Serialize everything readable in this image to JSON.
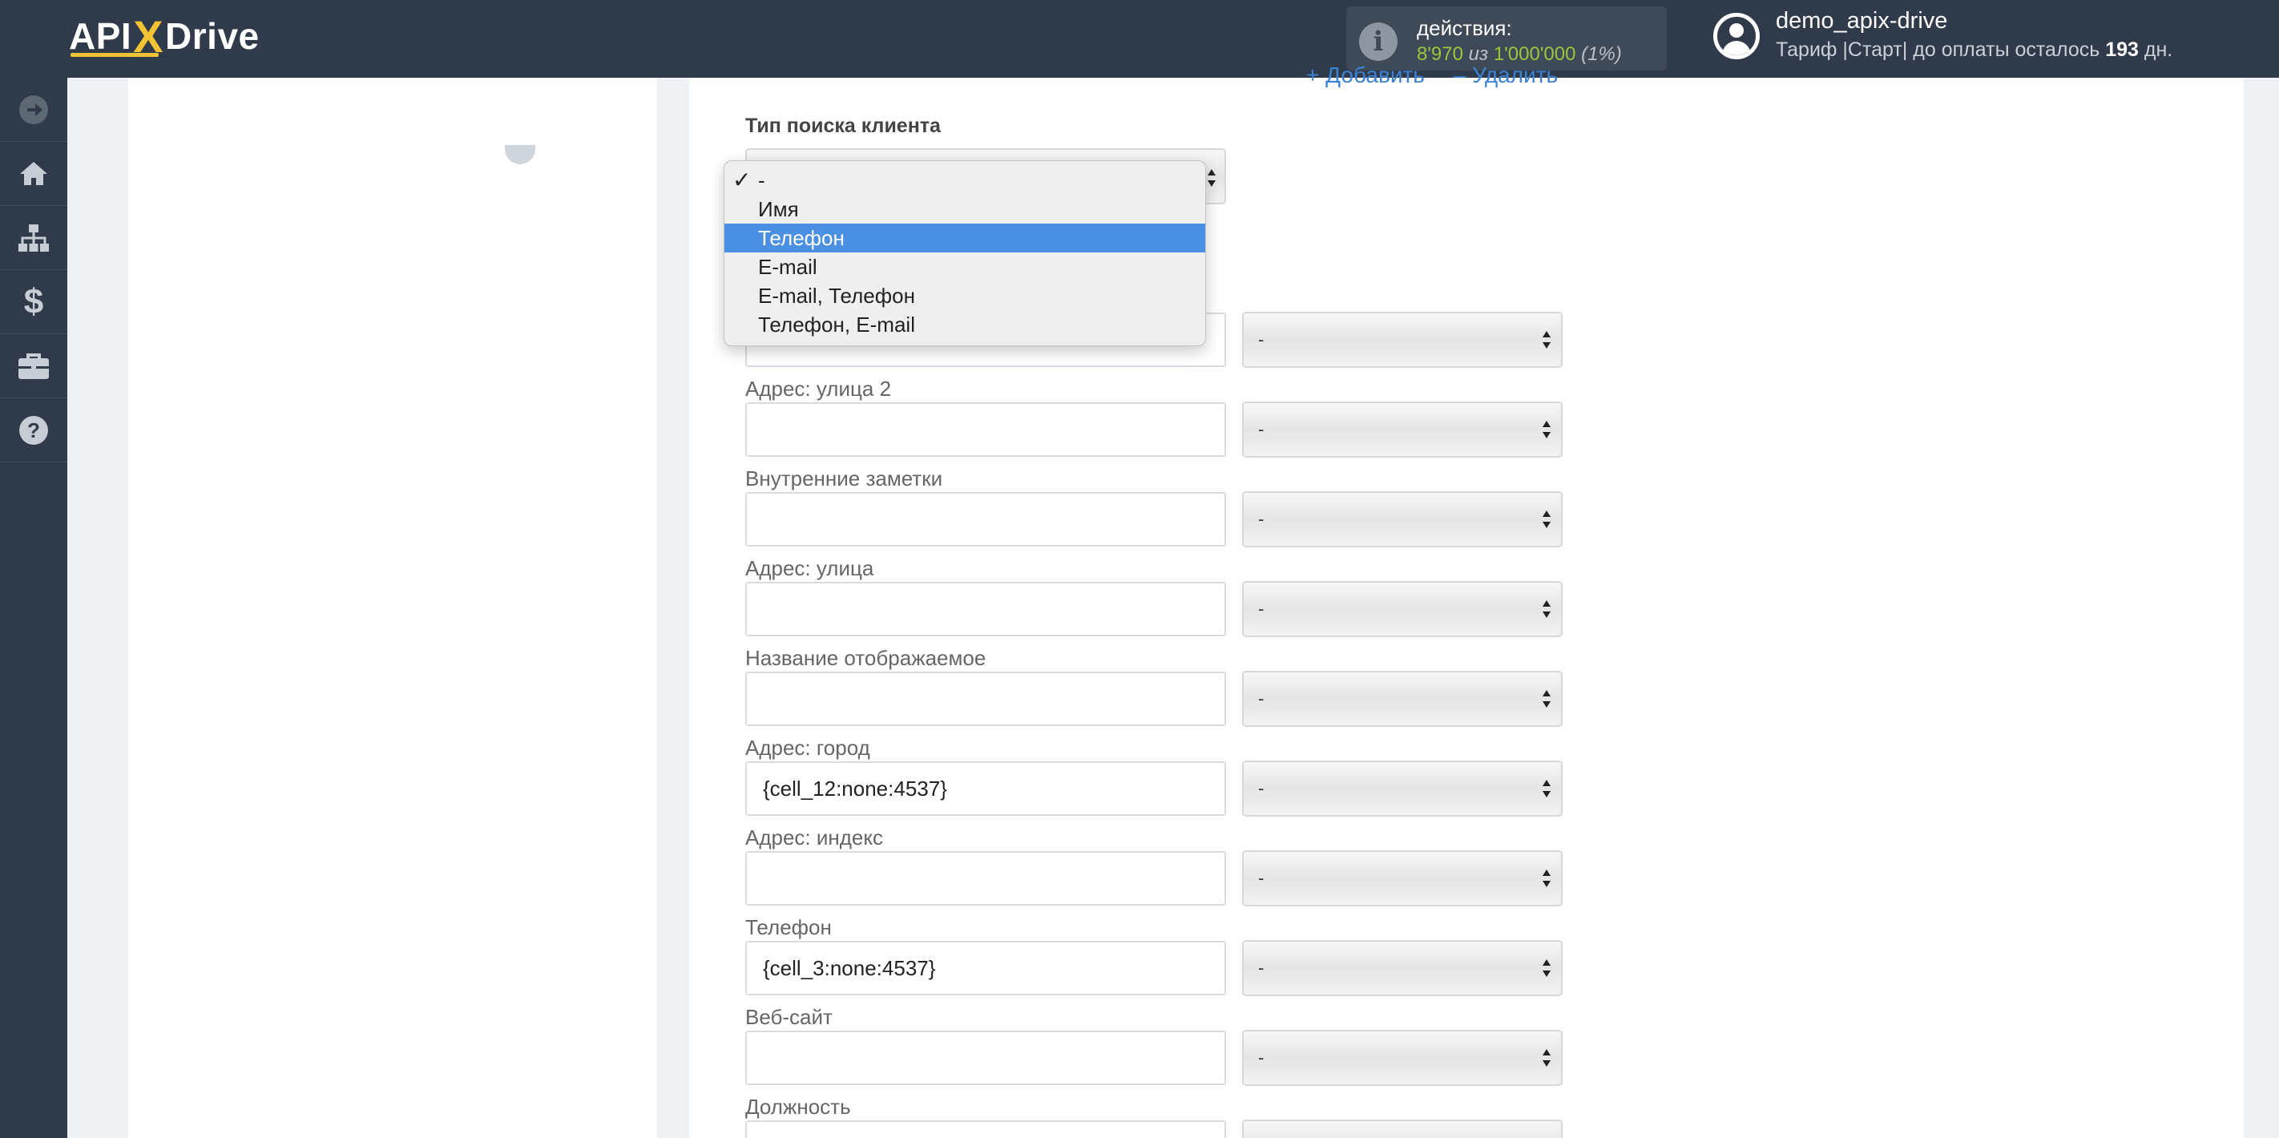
{
  "header": {
    "logo": {
      "pre": "API",
      "x": "X",
      "post": "Drive"
    },
    "actions": {
      "label": "действия:",
      "used": "8'970",
      "sep": "из",
      "total": "1'000'000",
      "percent": "(1%)"
    },
    "user": {
      "name": "demo_apix-drive",
      "tariff_prefix": "Тариф |Старт| до оплаты осталось",
      "days": "193",
      "days_suffix": "дн."
    }
  },
  "sidebar": {
    "items": [
      {
        "name": "arrow-right-icon"
      },
      {
        "name": "home-icon"
      },
      {
        "name": "sitemap-icon"
      },
      {
        "name": "dollar-icon"
      },
      {
        "name": "briefcase-icon"
      },
      {
        "name": "help-icon"
      }
    ]
  },
  "links": {
    "add": "+ Добавить",
    "remove": "– Удалить"
  },
  "search_type": {
    "label": "Тип поиска клиента",
    "options": [
      "-",
      "Имя",
      "Телефон",
      "E-mail",
      "E-mail, Телефон",
      "Телефон, E-mail"
    ],
    "checked_index": 0,
    "highlighted_index": 2
  },
  "fields": [
    {
      "label": "",
      "value": "",
      "select": "-"
    },
    {
      "label": "Адрес: улица 2",
      "value": "",
      "select": "-"
    },
    {
      "label": "Внутренние заметки",
      "value": "",
      "select": "-"
    },
    {
      "label": "Адрес: улица",
      "value": "",
      "select": "-"
    },
    {
      "label": "Название отображаемое",
      "value": "",
      "select": "-"
    },
    {
      "label": "Адрес: город",
      "value": "{cell_12:none:4537}",
      "select": "-"
    },
    {
      "label": "Адрес: индекс",
      "value": "",
      "select": "-"
    },
    {
      "label": "Телефон",
      "value": "{cell_3:none:4537}",
      "select": "-"
    },
    {
      "label": "Веб-сайт",
      "value": "",
      "select": "-"
    },
    {
      "label": "Должность",
      "value": "",
      "select": ""
    }
  ],
  "colors": {
    "topbar": "#2f3a4a",
    "accent_yellow": "#f2c434",
    "link_blue": "#3b82d6",
    "highlight": "#4a90e2",
    "green": "#9bc53d"
  }
}
